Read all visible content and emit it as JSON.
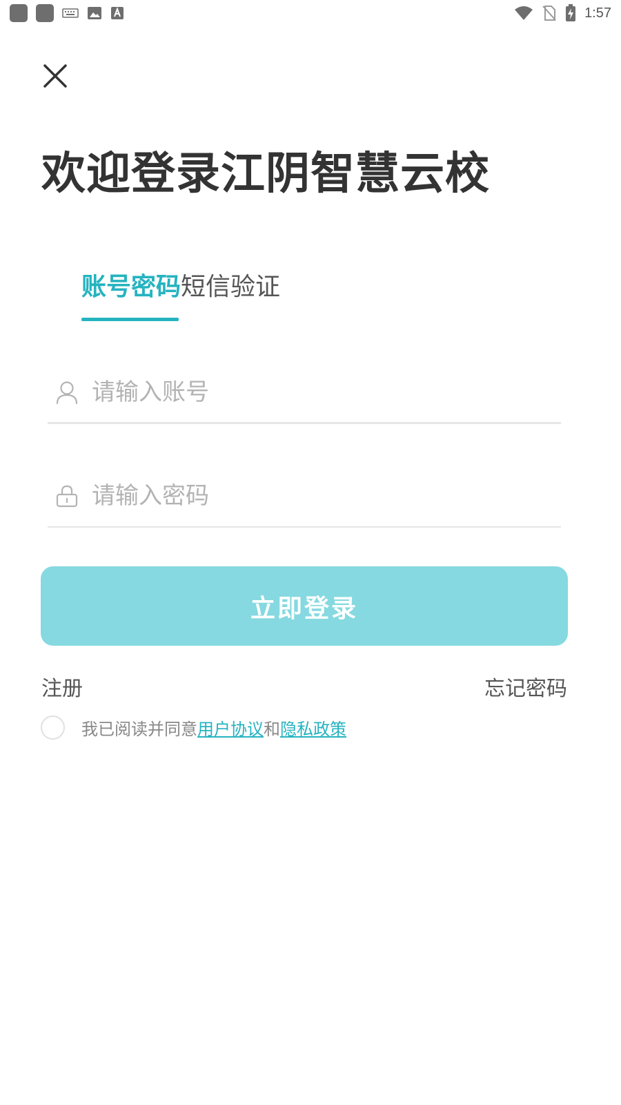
{
  "status_bar": {
    "time": "1:57",
    "left_icons": [
      "app-square-icon",
      "app-square-icon",
      "keyboard-icon",
      "image-icon",
      "font-a-icon"
    ],
    "right_icons": [
      "wifi-icon",
      "no-sim-icon",
      "battery-charging-icon"
    ]
  },
  "header": {
    "close_icon": "close-icon",
    "title": "欢迎登录江阴智慧云校"
  },
  "tabs": [
    {
      "label": "账号密码",
      "active": true
    },
    {
      "label": "短信验证",
      "active": false
    }
  ],
  "form": {
    "account": {
      "placeholder": "请输入账号",
      "value": "",
      "icon": "user-icon"
    },
    "password": {
      "placeholder": "请输入密码",
      "value": "",
      "icon": "lock-icon"
    },
    "login_label": "立即登录",
    "register_label": "注册",
    "forgot_label": "忘记密码"
  },
  "agreement": {
    "checked": false,
    "prefix": "我已阅读并同意",
    "user_agreement": "用户协议",
    "conjunction": "和",
    "privacy_policy": "隐私政策"
  },
  "colors": {
    "accent": "#25b3c0",
    "button": "#86d9e0",
    "text_dark": "#333333",
    "placeholder": "#b3b3b3"
  }
}
